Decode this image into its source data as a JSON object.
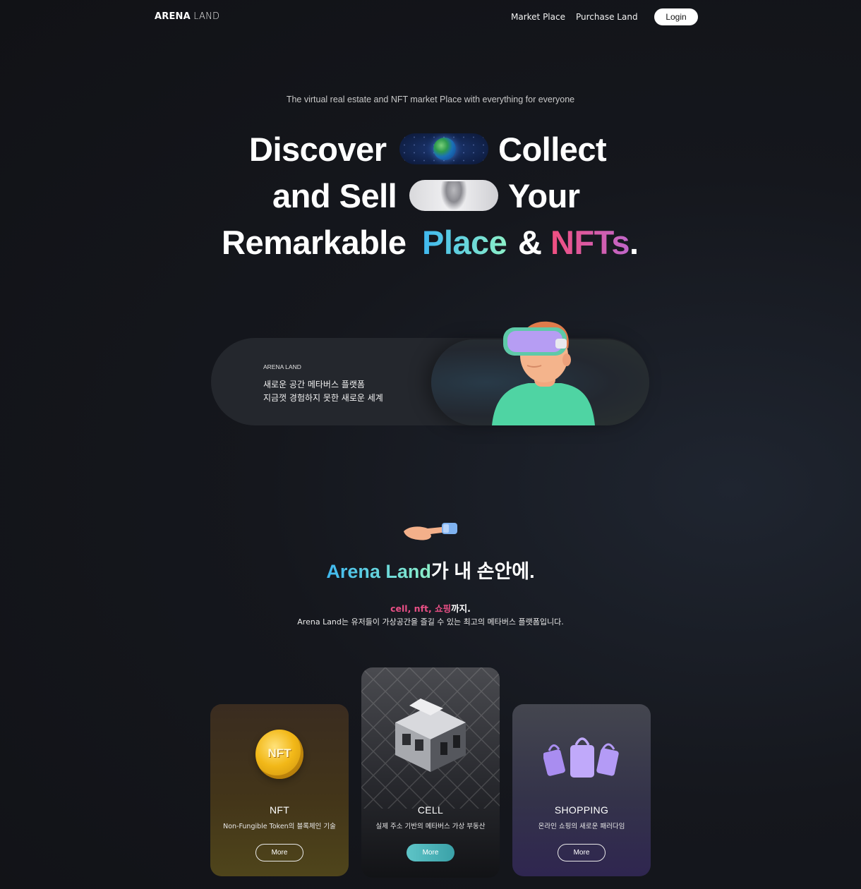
{
  "nav": {
    "logo_bold": "ARENA",
    "logo_light": "LAND",
    "links": [
      "Market Place",
      "Purchase Land"
    ],
    "login": "Login"
  },
  "hero": {
    "tagline": "The virtual real estate and NFT market Place with everything for everyone",
    "line1": [
      "Discover",
      "Collect"
    ],
    "line2": [
      "and Sell",
      "Your"
    ],
    "line3": {
      "w1": "Remarkable",
      "w2": "Place",
      "w3": "&",
      "w4": "NFTs",
      "w5": "."
    }
  },
  "banner": {
    "label": "ARENA LAND",
    "line1": "새로운 공간 메타버스 플랫폼",
    "line2": "지금껏 경험하지 못한 새로운 세계"
  },
  "section": {
    "title_grad": "Arena Land",
    "title_rest": "가 내 손안에.",
    "sub_pink": "cell, nft, 쇼핑",
    "sub_rest": "까지.",
    "desc": "Arena Land는 유저들이 가상공간을 즐길 수 있는 최고의 메타버스 플랫폼입니다."
  },
  "cards": [
    {
      "title": "NFT",
      "desc": "Non-Fungible Token의 블록체인 기술",
      "button": "More",
      "icon_text": "NFT"
    },
    {
      "title": "CELL",
      "desc": "실제 주소 기반의 메타버스 가상 부동산",
      "button": "More"
    },
    {
      "title": "SHOPPING",
      "desc": "온라인 쇼핑의 새로운 패러다임",
      "button": "More"
    }
  ],
  "colors": {
    "accent_blue": "#3fb8f0",
    "accent_green": "#8df0c8",
    "accent_pink": "#e84f85",
    "accent_teal": "#5ec4c7"
  }
}
